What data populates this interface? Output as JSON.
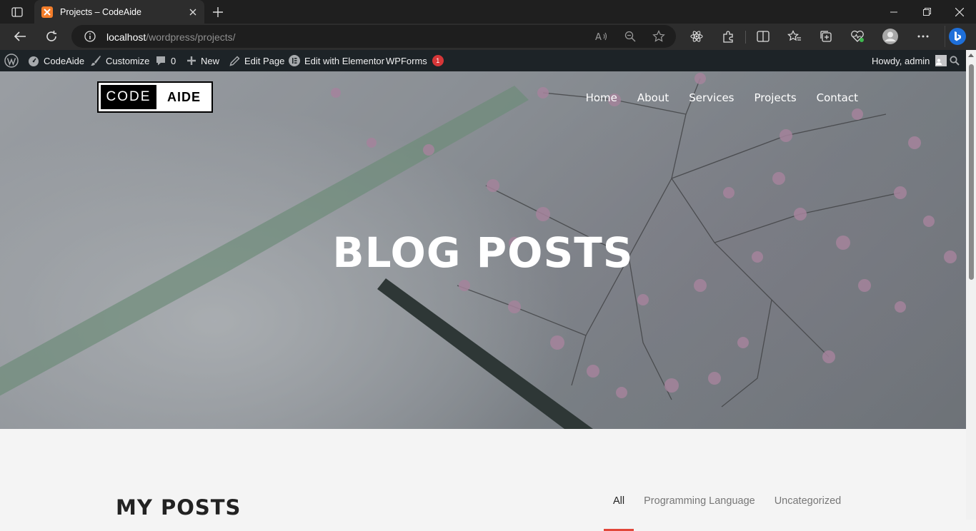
{
  "browser": {
    "tab_title": "Projects – CodeAide",
    "url_host": "localhost",
    "url_path": "/wordpress/projects/"
  },
  "admin_bar": {
    "site_name": "CodeAide",
    "customize": "Customize",
    "comments_count": "0",
    "new": "New",
    "edit_page": "Edit Page",
    "edit_elementor": "Edit with Elementor",
    "wpforms": "WPForms",
    "wpforms_badge": "1",
    "howdy": "Howdy, admin"
  },
  "site": {
    "logo_left": "CODE",
    "logo_right": "AIDE",
    "nav": [
      "Home",
      "About",
      "Services",
      "Projects",
      "Contact"
    ]
  },
  "hero": {
    "title": "BLOG POSTS"
  },
  "posts": {
    "heading": "MY POSTS",
    "filters": [
      "All",
      "Programming Language",
      "Uncategorized"
    ],
    "active_filter": "All"
  },
  "colors": {
    "accent": "#e2473a",
    "adminbar": "#1d2327",
    "browser_chrome": "#2d2d2d"
  }
}
